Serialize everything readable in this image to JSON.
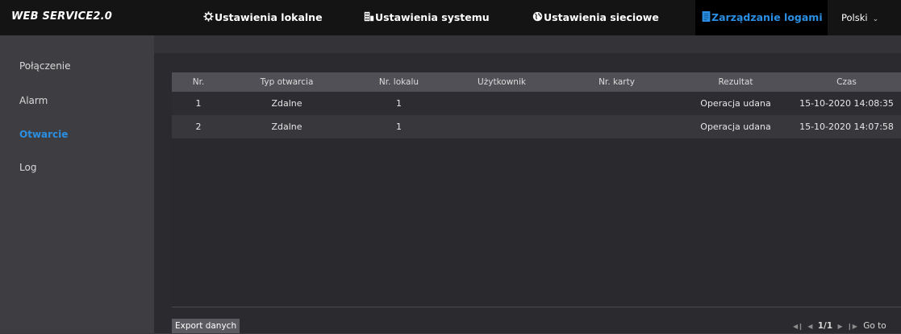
{
  "app": {
    "logo": "WEB SERVICE2.0"
  },
  "nav": {
    "items": [
      {
        "label": "Ustawienia lokalne",
        "icon": "gear-icon"
      },
      {
        "label": "Ustawienia systemu",
        "icon": "building-icon"
      },
      {
        "label": "Ustawienia sieciowe",
        "icon": "globe-icon"
      },
      {
        "label": "Zarządzanie logami",
        "icon": "log-icon",
        "active": true
      }
    ],
    "language": "Polski"
  },
  "sidebar": {
    "items": [
      {
        "label": "Połączenie"
      },
      {
        "label": "Alarm"
      },
      {
        "label": "Otwarcie",
        "active": true
      },
      {
        "label": "Log"
      }
    ]
  },
  "table": {
    "columns": [
      "Nr.",
      "Typ otwarcia",
      "Nr. lokalu",
      "Użytkownik",
      "Nr. karty",
      "Rezultat",
      "Czas"
    ],
    "rows": [
      {
        "nr": "1",
        "typ": "Zdalne",
        "lokal": "1",
        "uzytkownik": "",
        "karta": "",
        "rezultat": "Operacja udana",
        "czas": "15-10-2020 14:08:35"
      },
      {
        "nr": "2",
        "typ": "Zdalne",
        "lokal": "1",
        "uzytkownik": "",
        "karta": "",
        "rezultat": "Operacja udana",
        "czas": "15-10-2020 14:07:58"
      }
    ]
  },
  "footer": {
    "export_label": "Export danych",
    "page": "1/1",
    "goto_label": "Go to"
  },
  "colors": {
    "accent": "#2a8fe3",
    "topbar": "#141414",
    "sidebar": "#3e3e42",
    "main": "#2b2b2f",
    "table_header": "#505056"
  }
}
